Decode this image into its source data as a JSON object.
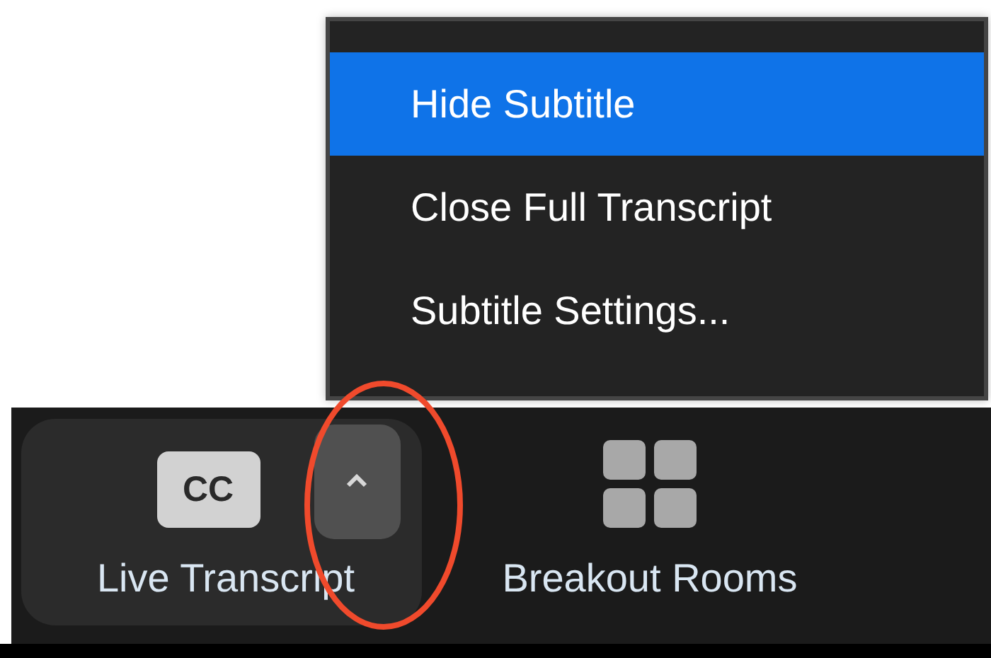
{
  "menu": {
    "items": [
      {
        "label": "Hide Subtitle",
        "selected": true
      },
      {
        "label": "Close Full Transcript",
        "selected": false
      },
      {
        "label": "Subtitle Settings...",
        "selected": false
      }
    ]
  },
  "toolbar": {
    "items": [
      {
        "kind": "transcript",
        "label": "Live Transcript",
        "badge": "CC"
      },
      {
        "kind": "breakout",
        "label": "Breakout Rooms"
      }
    ]
  }
}
